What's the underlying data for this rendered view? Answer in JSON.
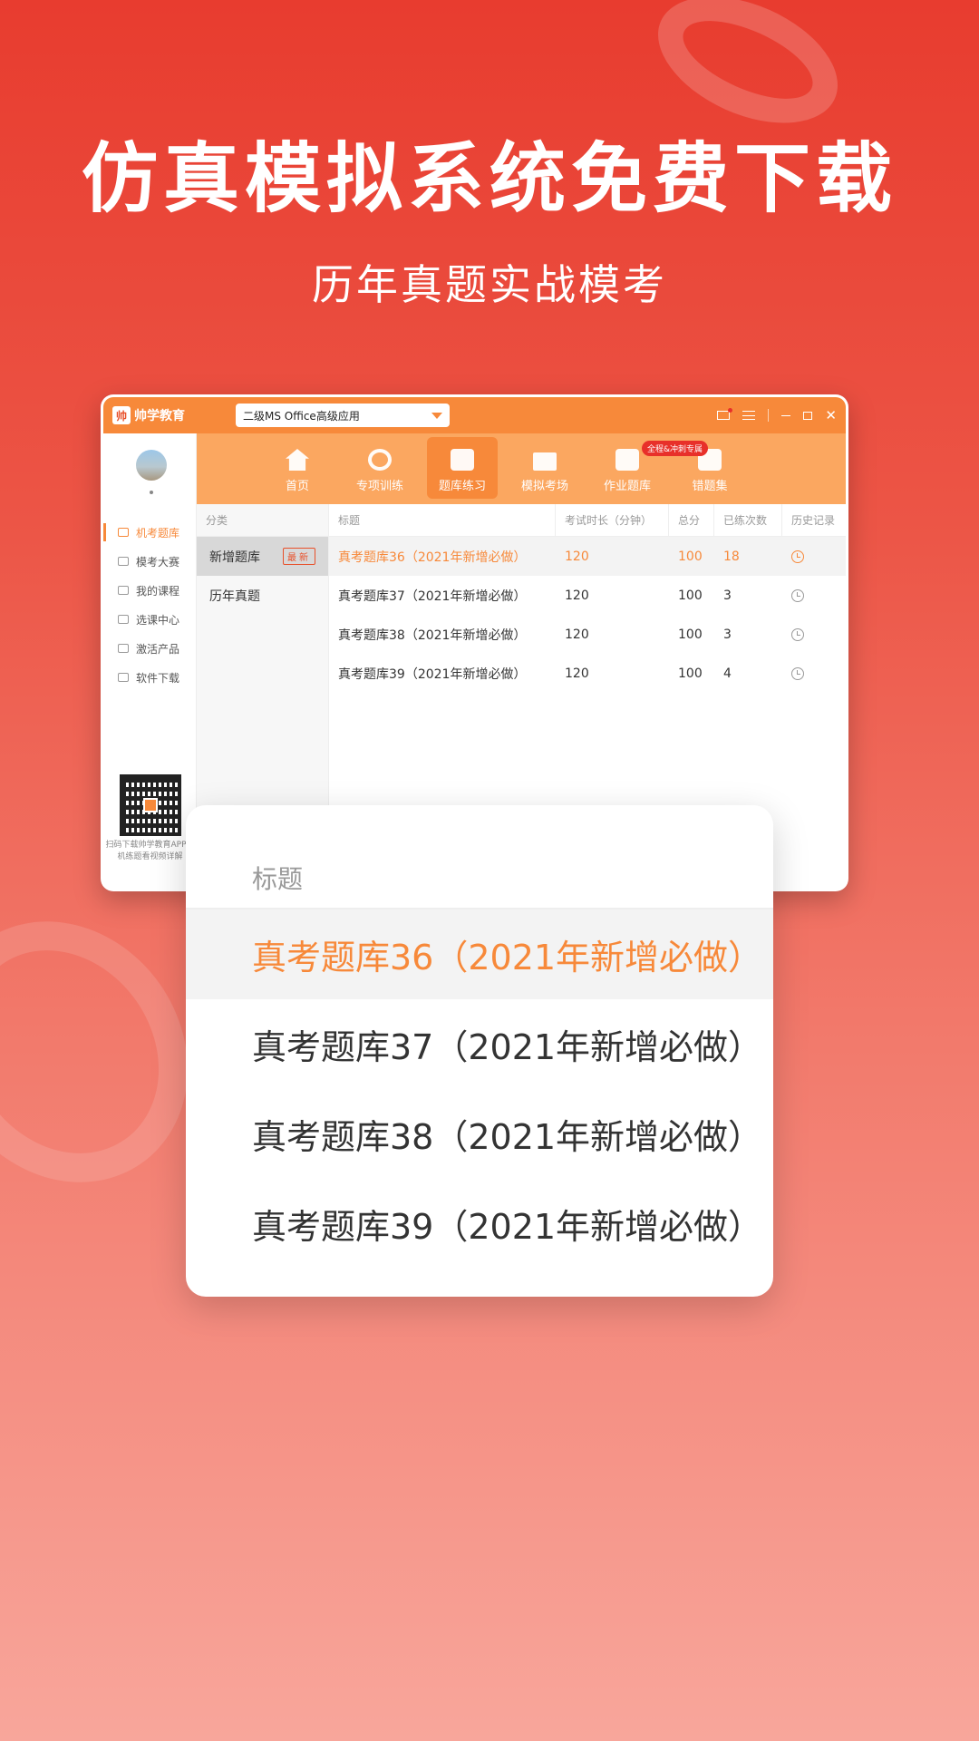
{
  "headline": "仿真模拟系统免费下载",
  "subline": "历年真题实战模考",
  "app": {
    "logo_text": "帅学教育",
    "course_select": "二级MS Office高级应用",
    "sidebar": {
      "items": [
        "机考题库",
        "模考大赛",
        "我的课程",
        "选课中心",
        "激活产品",
        "软件下载"
      ],
      "qr_caption": "扫码下载帅学教育APP手机练题看视频详解"
    },
    "nav": {
      "items": [
        "首页",
        "专项训练",
        "题库练习",
        "模拟考场",
        "作业题库",
        "错题集"
      ],
      "badge": "全程&冲刺专属"
    },
    "categories": {
      "header": "分类",
      "items": [
        "新增题库",
        "历年真题"
      ],
      "new_tag": "最新"
    },
    "table": {
      "headers": [
        "标题",
        "考试时长（分钟）",
        "总分",
        "已练次数",
        "历史记录"
      ],
      "rows": [
        {
          "title": "真考题库36（2021年新增必做）",
          "duration": "120",
          "score": "100",
          "count": "18"
        },
        {
          "title": "真考题库37（2021年新增必做）",
          "duration": "120",
          "score": "100",
          "count": "3"
        },
        {
          "title": "真考题库38（2021年新增必做）",
          "duration": "120",
          "score": "100",
          "count": "3"
        },
        {
          "title": "真考题库39（2021年新增必做）",
          "duration": "120",
          "score": "100",
          "count": "4"
        }
      ]
    }
  },
  "zoom": {
    "header": "标题",
    "rows": [
      "真考题库36（2021年新增必做）",
      "真考题库37（2021年新增必做）",
      "真考题库38（2021年新增必做）",
      "真考题库39（2021年新增必做）"
    ]
  },
  "colors": {
    "accent": "#f7893a",
    "bg_top": "#e83c2f",
    "bg_bottom": "#f8a69b"
  }
}
